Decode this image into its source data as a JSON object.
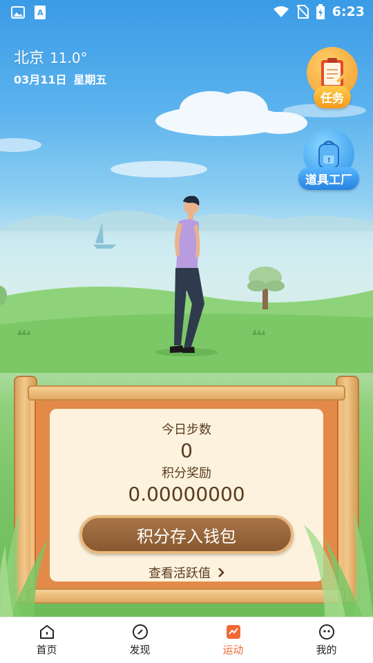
{
  "status_bar": {
    "time": "6:23"
  },
  "location": {
    "city": "北京",
    "temperature": "11.0°",
    "date": "03月11日",
    "weekday": "星期五"
  },
  "badges": [
    {
      "label": "任务",
      "icon": "clipboard-icon"
    },
    {
      "label": "道具工厂",
      "icon": "backpack-icon"
    }
  ],
  "panel": {
    "steps_label": "今日步数",
    "steps_value": "0",
    "points_label": "积分奖励",
    "points_value": "0.00000000",
    "deposit_button": "积分存入钱包",
    "view_activity": "查看活跃值"
  },
  "tabs": [
    {
      "label": "首页",
      "icon": "home-icon",
      "active": false
    },
    {
      "label": "发现",
      "icon": "compass-icon",
      "active": false
    },
    {
      "label": "运动",
      "icon": "activity-icon",
      "active": true
    },
    {
      "label": "我的",
      "icon": "profile-icon",
      "active": false
    }
  ],
  "colors": {
    "accent": "#f06a35",
    "board": "#e38a49",
    "button": "#8a5830"
  }
}
